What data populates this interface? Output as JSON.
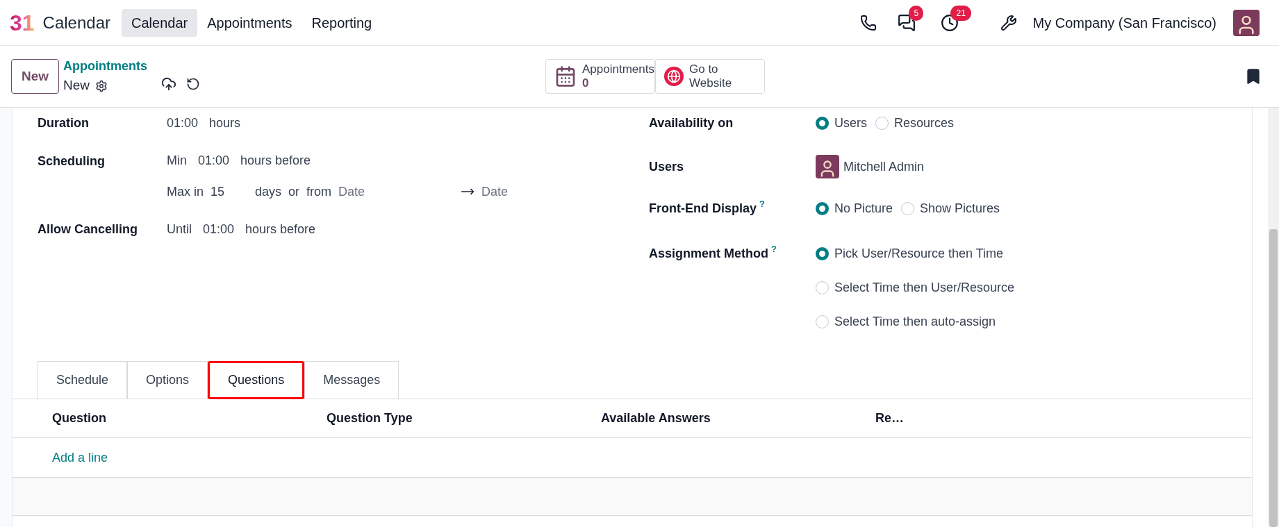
{
  "app": {
    "logo": "31",
    "name": "Calendar"
  },
  "menu": [
    {
      "label": "Calendar",
      "selected": true
    },
    {
      "label": "Appointments",
      "selected": false
    },
    {
      "label": "Reporting",
      "selected": false
    }
  ],
  "systray": {
    "messages_badge": "5",
    "activities_badge": "21",
    "company": "My Company (San Francisco)"
  },
  "control_panel": {
    "new_button": "New",
    "breadcrumb": "Appointments",
    "record": "New",
    "smart_buttons": [
      {
        "kind": "calendar",
        "label": "Appointments",
        "value": "0"
      },
      {
        "kind": "website",
        "label": "Go to Website"
      }
    ]
  },
  "duration": {
    "label": "Duration",
    "value": "01:00",
    "unit": "hours"
  },
  "scheduling": {
    "label": "Scheduling",
    "min_label": "Min",
    "min_value": "01:00",
    "min_unit": "hours before",
    "max_label": "Max in",
    "max_value": "15",
    "max_unit": "days",
    "or": "or",
    "from": "from",
    "start_placeholder": "Date",
    "end_placeholder": "Date"
  },
  "allow_cancelling": {
    "label": "Allow Cancelling",
    "prefix": "Until",
    "value": "01:00",
    "unit": "hours before"
  },
  "availability": {
    "label": "Availability on",
    "options": [
      {
        "label": "Users",
        "selected": true
      },
      {
        "label": "Resources",
        "selected": false
      }
    ]
  },
  "users": {
    "label": "Users",
    "tags": [
      "Mitchell Admin"
    ]
  },
  "front_end": {
    "label": "Front-End Display",
    "help": "?",
    "options": [
      {
        "label": "No Picture",
        "selected": true
      },
      {
        "label": "Show Pictures",
        "selected": false
      }
    ]
  },
  "assignment": {
    "label": "Assignment Method",
    "help": "?",
    "options": [
      {
        "label": "Pick User/Resource then Time",
        "selected": true
      },
      {
        "label": "Select Time then User/Resource",
        "selected": false
      },
      {
        "label": "Select Time then auto-assign",
        "selected": false
      }
    ]
  },
  "tabs": [
    {
      "label": "Schedule",
      "selected": false,
      "outlined": false
    },
    {
      "label": "Options",
      "selected": false,
      "outlined": false
    },
    {
      "label": "Questions",
      "selected": true,
      "outlined": true
    },
    {
      "label": "Messages",
      "selected": false,
      "outlined": false
    }
  ],
  "table": {
    "columns": [
      "Question",
      "Question Type",
      "Available Answers",
      "Re…"
    ],
    "add_line": "Add a line"
  }
}
